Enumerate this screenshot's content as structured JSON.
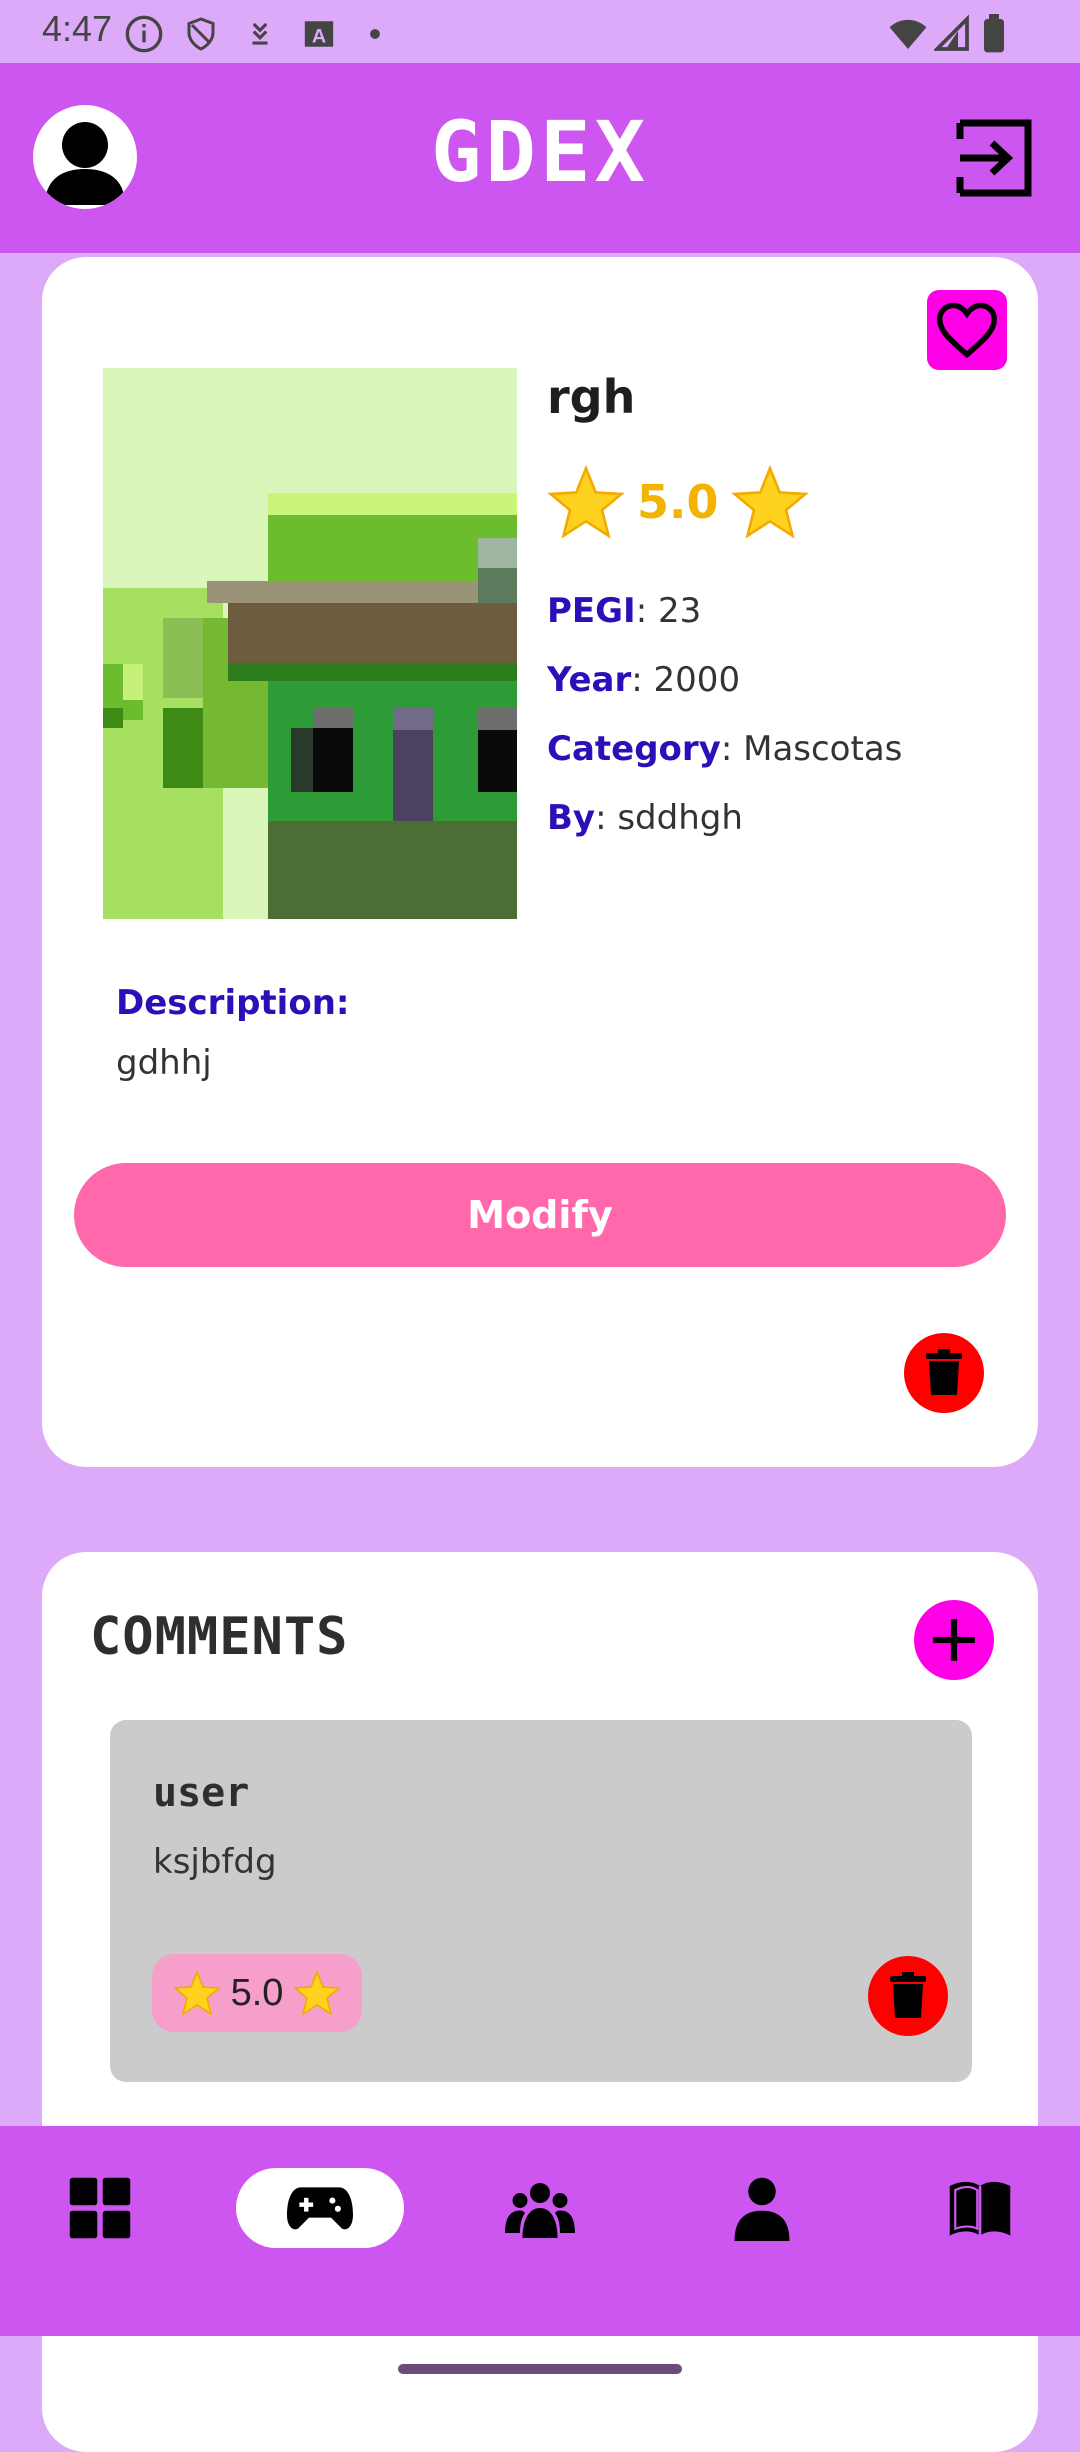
{
  "status_bar": {
    "time": "4:47",
    "icons_left": [
      "info-icon",
      "shield-icon",
      "download-icon",
      "font-icon",
      "dot-icon"
    ],
    "icons_right": [
      "wifi-icon",
      "signal-icon",
      "battery-icon"
    ]
  },
  "header": {
    "title": "GDEX",
    "avatar_icon": "person-icon",
    "logout_icon": "logout-icon"
  },
  "game": {
    "name": "rgh",
    "rating": "5.0",
    "pegi_label": "PEGI",
    "pegi_value": ": 23",
    "year_label": "Year",
    "year_value": ": 2000",
    "category_label": "Category",
    "category_value": ": Mascotas",
    "by_label": "By",
    "by_value": ": sddhgh",
    "description_label": "Description:",
    "description_text": "gdhhj",
    "modify_label": "Modify"
  },
  "comments": {
    "title": "COMMENTS",
    "items": [
      {
        "user": "user",
        "text": "ksjbfdg",
        "rating": "5.0"
      }
    ]
  },
  "bottom_nav": {
    "items": [
      "dashboard-icon",
      "gamepad-icon",
      "group-icon",
      "person-icon",
      "book-icon"
    ],
    "active": "gamepad-icon"
  },
  "colors": {
    "accent": "#cd55f0",
    "background": "#dcaaf8",
    "pink_button": "#ff69ab",
    "magenta": "#ff00e6",
    "label_blue": "#2a10b8",
    "star": "#f2b400",
    "danger": "#ff0000"
  }
}
